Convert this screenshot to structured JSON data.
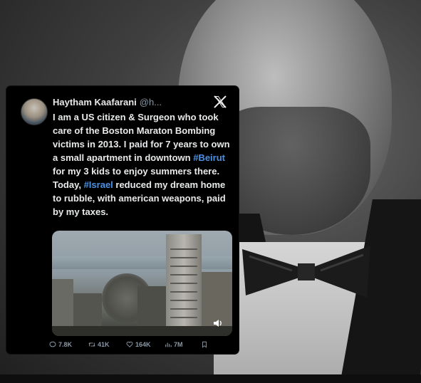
{
  "tweet": {
    "author_name": "Haytham Kaafarani",
    "author_handle": "@h...",
    "text_parts": {
      "p1": "I am a US citizen & Surgeon who took care of the Boston Maraton Bombing victims in 2013. I paid for 7 years to own a small apartment in downtown ",
      "hashtag1": "#Beirut",
      "p2": " for my 3 kids to enjoy summers there. Today, ",
      "hashtag2": "#Israel",
      "p3": " reduced my dream home to rubble, with american weapons, paid by my taxes."
    },
    "stats": {
      "replies": "7.8K",
      "reposts": "41K",
      "likes": "164K",
      "views": "7M"
    },
    "icons": {
      "logo": "x-logo-icon",
      "reply": "reply-icon",
      "repost": "repost-icon",
      "like": "heart-icon",
      "views": "views-icon",
      "bookmark": "bookmark-icon",
      "sound": "sound-icon"
    }
  },
  "colors": {
    "card_bg": "#000000",
    "text": "#e7e9ea",
    "muted": "#8b98a5",
    "hashtag": "#4a90e2"
  }
}
